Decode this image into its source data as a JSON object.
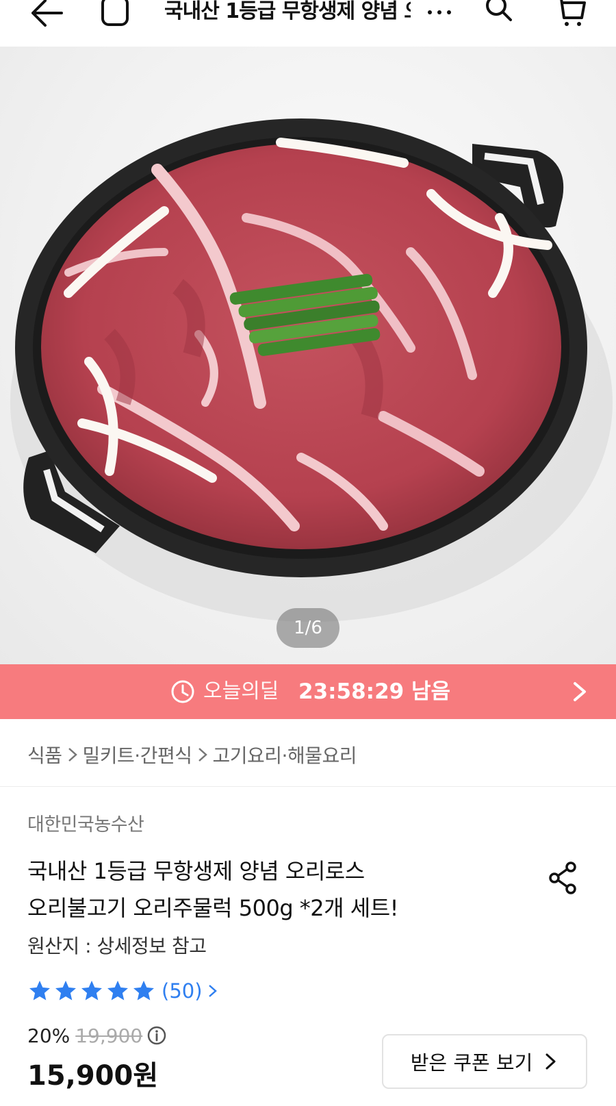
{
  "header": {
    "title": "국내산 1등급 무항생제 양념 오리로스 오리불고기 오리주물럭 500g *2개 세트!",
    "icons": [
      "back-arrow-icon",
      "home-icon",
      "more-icon",
      "search-icon",
      "cart-icon"
    ]
  },
  "gallery": {
    "counter": "1/6",
    "image_description_icon": "product-photo"
  },
  "deal": {
    "label": "오늘의딜",
    "timer": "23:58:29 남음",
    "accent_color": "#f77b7e"
  },
  "breadcrumb": [
    "식품",
    "밀키트·간편식",
    "고기요리·해물요리"
  ],
  "product": {
    "seller": "대한민국농수산",
    "title_line1": "국내산 1등급 무항생제  양념 오리로스",
    "title_line2": "오리불고기 오리주물럭 500g *2개 세트!",
    "origin": "원산지 : 상세정보 참고",
    "rating_stars": 5,
    "review_count": "(50)",
    "discount": "20%",
    "original_price": "19,900",
    "price": "15,900원",
    "star_color": "#2f7ff0"
  },
  "coupon": {
    "label": "받은 쿠폰 보기"
  }
}
